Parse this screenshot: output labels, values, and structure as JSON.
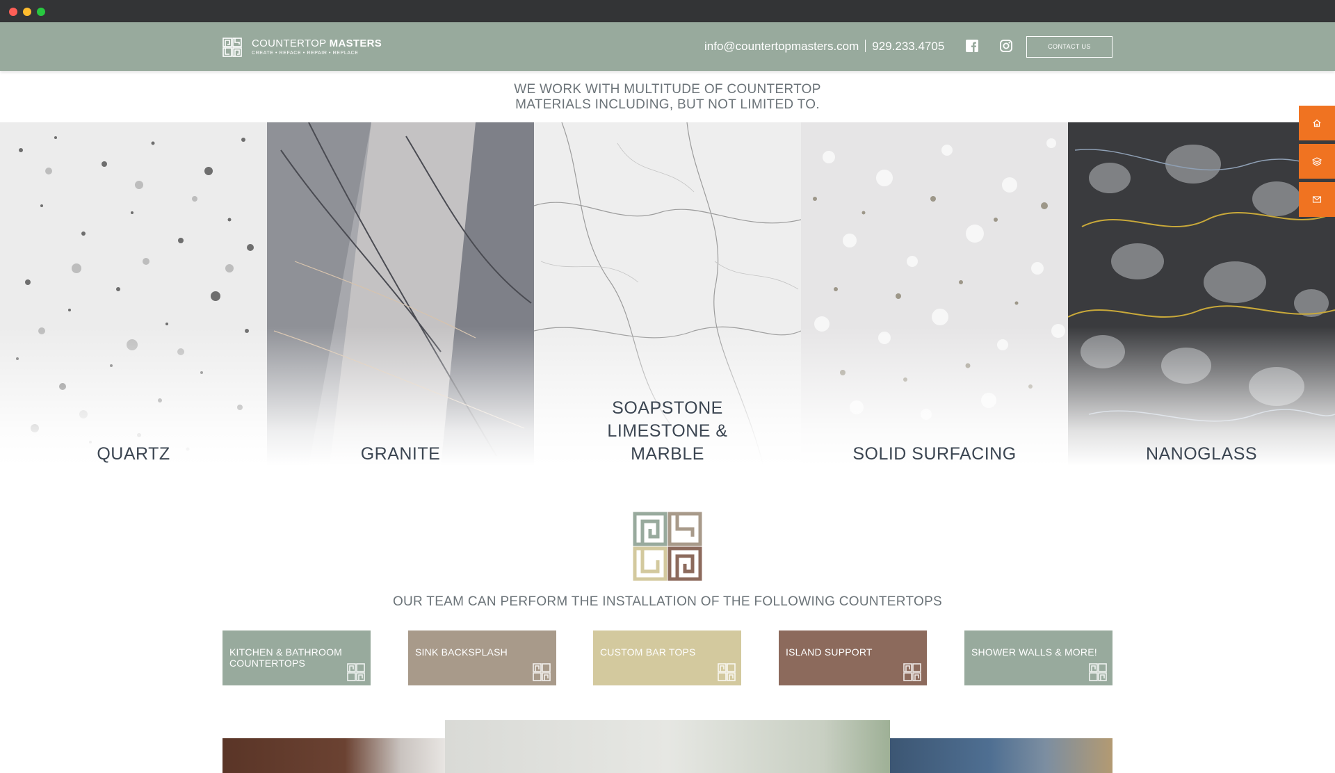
{
  "header": {
    "brand_prefix": "COUNTERTOP",
    "brand_suffix": "MASTERS",
    "tagline": "CREATE • REFACE • REPAIR • REPLACE",
    "email": "info@countertopmasters.com",
    "phone": "929.233.4705",
    "contact_button": "CONTACT US",
    "icons": [
      "facebook-icon",
      "instagram-icon"
    ]
  },
  "intro": {
    "line1": "WE WORK WITH MULTITUDE OF COUNTERTOP",
    "line2": "MATERIALS INCLUDING, BUT NOT LIMITED TO."
  },
  "materials": [
    {
      "label": "QUARTZ"
    },
    {
      "label": "GRANITE"
    },
    {
      "label_lines": [
        "SOAPSTONE",
        "LIMESTONE &",
        "MARBLE"
      ]
    },
    {
      "label": "SOLID SURFACING"
    },
    {
      "label": "NANOGLASS"
    }
  ],
  "side_buttons": [
    "home-icon",
    "layers-icon",
    "mail-icon"
  ],
  "services": {
    "heading": "OUR TEAM CAN PERFORM THE INSTALLATION OF THE FOLLOWING COUNTERTOPS",
    "cards": [
      {
        "line1": "KITCHEN & BATHROOM",
        "line2": "COUNTERTOPS"
      },
      {
        "line1": "SINK BACKSPLASH"
      },
      {
        "line1": "CUSTOM BAR TOPS"
      },
      {
        "line1": "ISLAND SUPPORT"
      },
      {
        "line1": "SHOWER WALLS & MORE!"
      }
    ]
  },
  "colors": {
    "header_bg": "#98aa9d",
    "accent_orange": "#f07321",
    "card_sage": "#98aa9d",
    "card_taupe": "#a89a8a",
    "card_sand": "#d3c99e",
    "card_brown": "#8c6a5c",
    "text_dark": "#3c4652"
  }
}
